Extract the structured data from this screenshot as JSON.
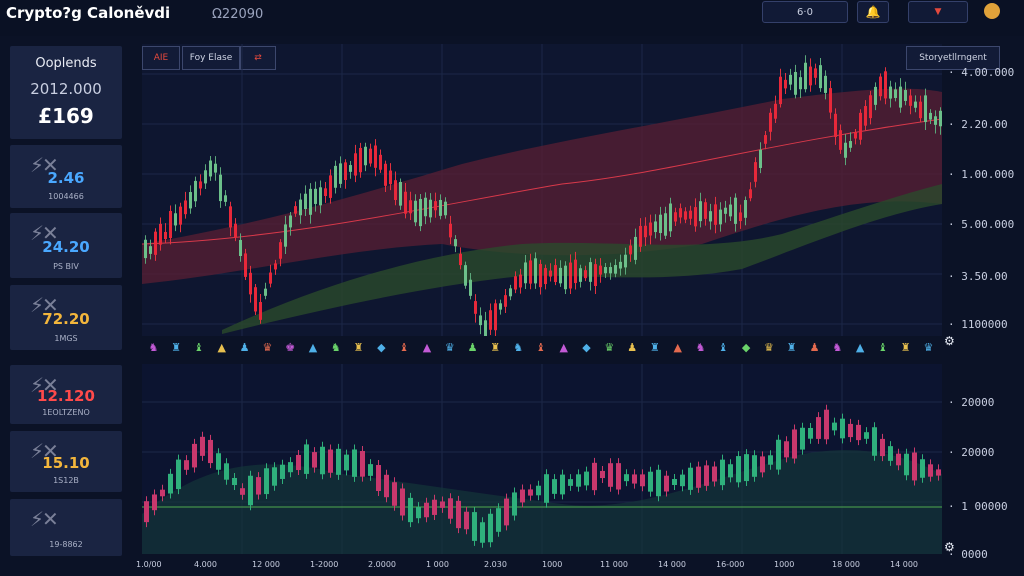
{
  "app": {
    "title": "Crypto?g Caloněvdi",
    "subtitle": "Ω22090"
  },
  "toolbar": {
    "value_box": "6·0",
    "bell_icon": "bell-icon",
    "dropdown_icon": "chevron-down-icon",
    "coin_icon": "coin-icon"
  },
  "sidebar": {
    "overview": {
      "title": "Ooplends",
      "date": "2012.000",
      "value": "£169"
    },
    "stats": [
      {
        "value": "2.46",
        "label": "1004466",
        "color": "#4aa8ff"
      },
      {
        "value": "24.20",
        "label": "PS BIV",
        "color": "#4aa8ff"
      },
      {
        "value": "72.20",
        "label": "1MGS",
        "color": "#f3b63c"
      },
      {
        "value": "12.120",
        "label": "1EOLTZENO",
        "color": "#ff4a4a"
      },
      {
        "value": "15.10",
        "label": "1S12B",
        "color": "#f3b63c"
      },
      {
        "value": "",
        "label": "19-8862",
        "color": "#4aa8ff"
      }
    ]
  },
  "main_chart": {
    "tools": [
      "AIE",
      "Foy Elase",
      "⇄"
    ],
    "overlay_button": "Storyetllrngent",
    "y_labels": [
      "4.00.000",
      "2.20.00",
      "1.00.000",
      "5.00.000",
      "3.50.00",
      "1100000"
    ],
    "settings_icon": "gear-icon"
  },
  "volume_chart": {
    "y_labels": [
      "20000",
      "20000",
      "1 00000",
      "0000"
    ],
    "x_labels": [
      "1.0/00",
      "4.000",
      "12 000",
      "1-2000",
      "2.0000",
      "1 000",
      "2.030",
      "1000",
      "11 000",
      "14 000",
      "16-000",
      "1000",
      "18 000",
      "14 000"
    ]
  },
  "chart_data": [
    {
      "type": "candlestick",
      "title": "",
      "ylim": [
        1100000,
        4000000
      ],
      "y_ticks": [
        "4.00.000",
        "2.20.00",
        "1.00.000",
        "5.00.000",
        "3.50.00",
        "1100000"
      ],
      "bands": [
        "upper-red",
        "lower-green"
      ],
      "grid": true
    },
    {
      "type": "candlestick",
      "title": "",
      "y_ticks": [
        "20000",
        "20000",
        "1 00000",
        "0000"
      ],
      "x_ticks": [
        "1.0/00",
        "4.000",
        "12 000",
        "1-2000",
        "2.0000",
        "1 000",
        "2.030",
        "1000",
        "11 000",
        "14 000",
        "16-000",
        "1000",
        "18 000",
        "14 000"
      ],
      "grid": true
    }
  ]
}
